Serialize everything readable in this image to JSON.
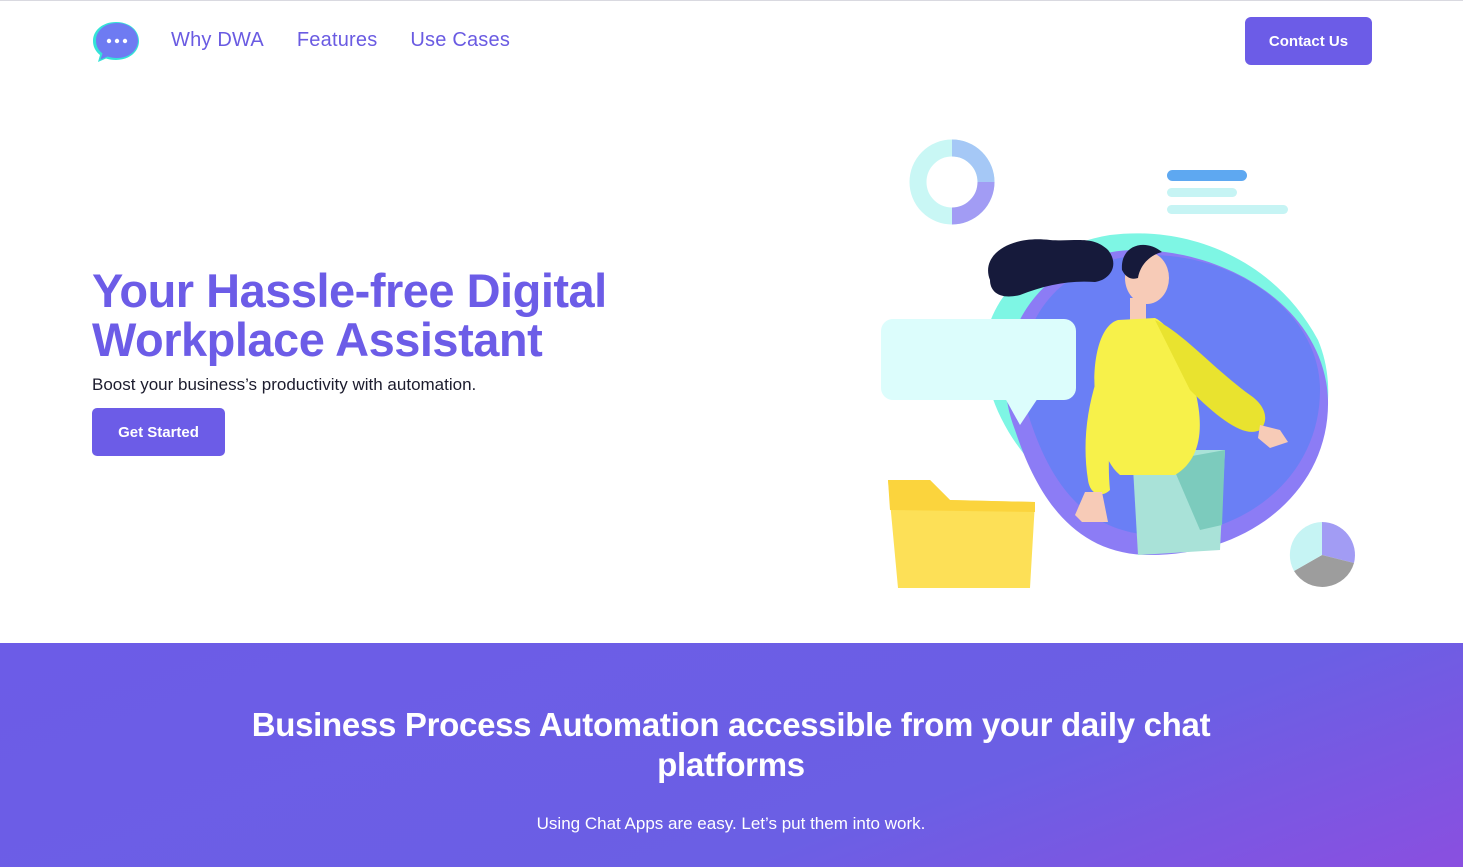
{
  "header": {
    "logo_icon": "chat-bubble-dots-icon",
    "nav": [
      {
        "label": "Why DWA"
      },
      {
        "label": "Features"
      },
      {
        "label": "Use Cases"
      }
    ],
    "contact_label": "Contact Us"
  },
  "hero": {
    "title": "Your Hassle-free Digital Workplace Assistant",
    "subtitle": "Boost your business’s productivity with automation.",
    "cta_label": "Get Started"
  },
  "band": {
    "title": "Business Process Automation accessible from your daily chat platforms",
    "subtitle": "Using Chat Apps are easy. Let’s put them into work."
  },
  "colors": {
    "brand": "#6c5ce7",
    "accent_teal": "#7ef6e4",
    "accent_yellow": "#f7f14a"
  }
}
